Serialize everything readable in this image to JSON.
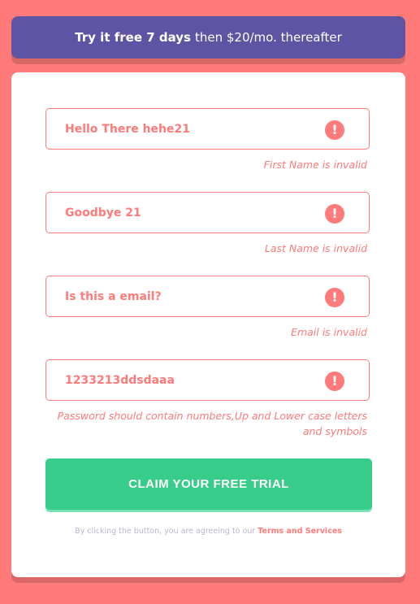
{
  "promo": {
    "bold": "Try it free 7 days",
    "rest": "then $20/mo. thereafter"
  },
  "fields": [
    {
      "value": "Hello There hehe21",
      "error": "First Name is invalid"
    },
    {
      "value": "Goodbye 21",
      "error": "Last Name is invalid"
    },
    {
      "value": "Is this a email?",
      "error": "Email is invalid"
    },
    {
      "value": "1233213ddsdaaa",
      "error_line1": "Password should contain numbers,Up and Lower case letters",
      "error_line2": "and symbols"
    }
  ],
  "error_icon": {
    "name": "exclamation-circle-icon",
    "glyph": "!"
  },
  "cta": {
    "label": "CLAIM YOUR FREE TRIAL"
  },
  "terms": {
    "text": "By clicking the button, you are agreeing to our",
    "link": "Terms and Services"
  },
  "colors": {
    "background": "#ff7a78",
    "promo": "#5e54a4",
    "error": "#ff7a7a",
    "cta": "#38cc8b",
    "muted": "#b9b6d3"
  }
}
